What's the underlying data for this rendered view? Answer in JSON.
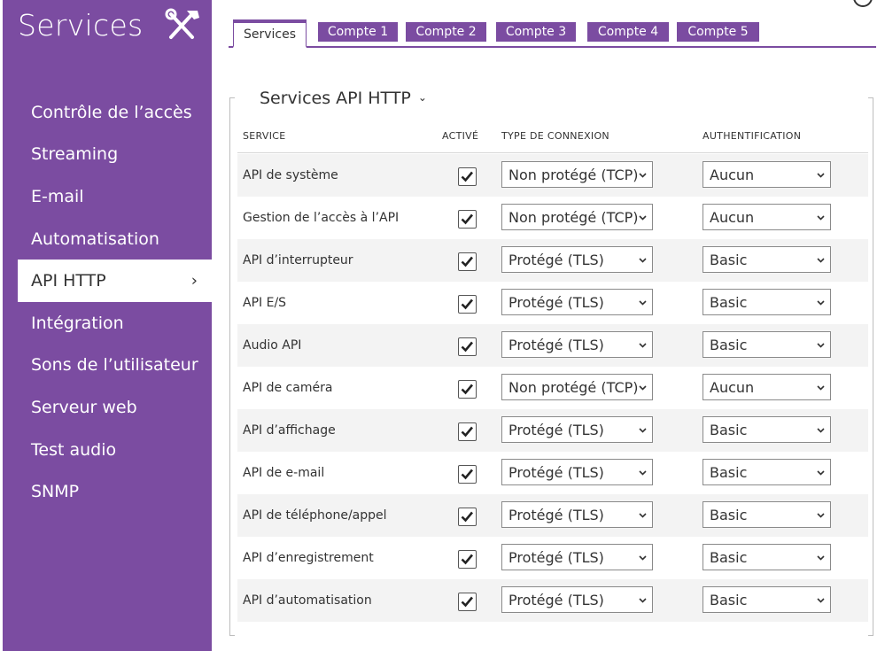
{
  "sidebar": {
    "title": "Services",
    "title_icon": "tools-icon",
    "items": [
      {
        "label": "Contrôle de l’accès"
      },
      {
        "label": "Streaming"
      },
      {
        "label": "E-mail"
      },
      {
        "label": "Automatisation"
      },
      {
        "label": "API HTTP",
        "active": true,
        "chevron": "›"
      },
      {
        "label": "Intégration"
      },
      {
        "label": "Sons de l’utilisateur"
      },
      {
        "label": "Serveur web"
      },
      {
        "label": "Test audio"
      },
      {
        "label": "SNMP"
      }
    ]
  },
  "tabs": [
    {
      "label": "Services",
      "active": true
    },
    {
      "label": "Compte 1"
    },
    {
      "label": "Compte 2"
    },
    {
      "label": "Compte 3"
    },
    {
      "label": "Compte 4"
    },
    {
      "label": "Compte 5"
    }
  ],
  "section": {
    "title": "Services API HTTP",
    "chevron": "⌄"
  },
  "table": {
    "headers": {
      "service": "SERVICE",
      "active": "ACTIVÉ",
      "connection": "TYPE DE CONNEXION",
      "auth": "AUTHENTIFICATION"
    },
    "rows": [
      {
        "service": "API de système",
        "enabled": true,
        "connection": "Non protégé (TCP)",
        "auth": "Aucun"
      },
      {
        "service": "Gestion de l’accès à l’API",
        "enabled": true,
        "connection": "Non protégé (TCP)",
        "auth": "Aucun"
      },
      {
        "service": "API d’interrupteur",
        "enabled": true,
        "connection": "Protégé (TLS)",
        "auth": "Basic"
      },
      {
        "service": "API E/S",
        "enabled": true,
        "connection": "Protégé (TLS)",
        "auth": "Basic"
      },
      {
        "service": "Audio API",
        "enabled": true,
        "connection": "Protégé (TLS)",
        "auth": "Basic"
      },
      {
        "service": "API de caméra",
        "enabled": true,
        "connection": "Non protégé (TCP)",
        "auth": "Aucun"
      },
      {
        "service": "API d’affichage",
        "enabled": true,
        "connection": "Protégé (TLS)",
        "auth": "Basic"
      },
      {
        "service": "API de e-mail",
        "enabled": true,
        "connection": "Protégé (TLS)",
        "auth": "Basic"
      },
      {
        "service": "API de téléphone/appel",
        "enabled": true,
        "connection": "Protégé (TLS)",
        "auth": "Basic"
      },
      {
        "service": "API d’enregistrement",
        "enabled": true,
        "connection": "Protégé (TLS)",
        "auth": "Basic"
      },
      {
        "service": "API d’automatisation",
        "enabled": true,
        "connection": "Protégé (TLS)",
        "auth": "Basic"
      }
    ]
  },
  "colors": {
    "accent": "#7b4ca1",
    "row_alt": "#f3f3f3",
    "text": "#333333"
  }
}
